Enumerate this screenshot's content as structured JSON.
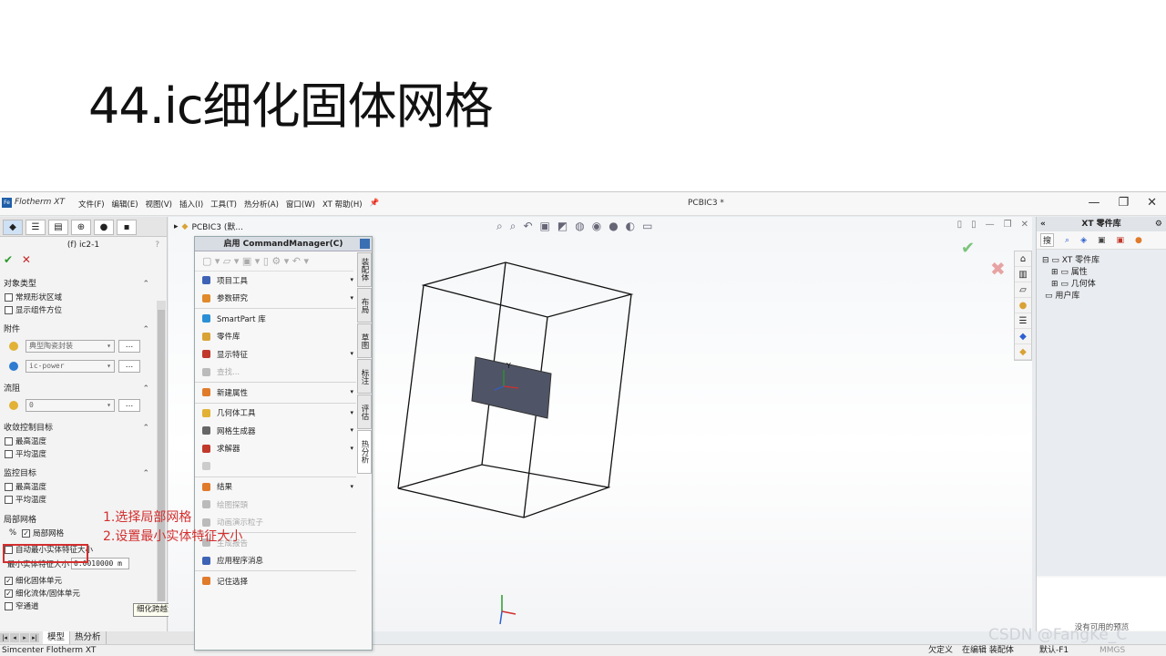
{
  "slide_title": "44.ic细化固体网格",
  "app": {
    "logo": "Fe",
    "name": "Flotherm XT",
    "menu": [
      "文件(F)",
      "编辑(E)",
      "视图(V)",
      "插入(I)",
      "工具(T)",
      "热分析(A)",
      "窗口(W)",
      "XT 帮助(H)"
    ],
    "document_title": "PCBIC3 *",
    "window_controls": [
      "—",
      "❐",
      "✕"
    ]
  },
  "left_panel": {
    "header": "(f) ic2-1",
    "help": "?",
    "ok": "✔",
    "cancel": "✕",
    "sections": {
      "object_type": {
        "title": "对象类型",
        "items": [
          "常规形状区域",
          "显示组件方位"
        ]
      },
      "attachment": {
        "title": "附件",
        "combo1": "典型陶瓷封装",
        "combo2": "ic-power",
        "dots": "..."
      },
      "flow": {
        "title": "流阻",
        "combo": "0",
        "dots": "..."
      },
      "convergence": {
        "title": "收敛控制目标",
        "items": [
          "最高温度",
          "平均温度"
        ]
      },
      "monitor": {
        "title": "监控目标",
        "items": [
          "最高温度",
          "平均温度"
        ]
      },
      "local_mesh": {
        "title": "局部网格",
        "mesh_icon": "%",
        "checkbox_label": "局部网格",
        "auto_label": "自动最小实体特征大小",
        "min_label": "最小实体特征大小",
        "min_value": "0.0010000 m",
        "refine_solid": "细化固体单元",
        "refine_fluid_solid": "细化流体/固体单元",
        "narrow": "窄通道"
      }
    },
    "tooltip": "细化跨越流体/固体交界面的单元",
    "bottom_tabs": [
      "模型",
      "热分析"
    ]
  },
  "annotations": [
    "1.选择局部网格",
    "2.设置最小实体特征大小"
  ],
  "viewport": {
    "tree_root": "PCBIC3 (默...",
    "axis_label": "Y"
  },
  "command_manager": {
    "title": "启用 CommandManager(C)",
    "items": [
      {
        "label": "项目工具",
        "color": "#3e63b5",
        "arrow": true,
        "disabled": false
      },
      {
        "label": "参数研究",
        "color": "#e08a2c",
        "arrow": true,
        "disabled": false
      },
      {
        "sep": true
      },
      {
        "label": "SmartPart 库",
        "color": "#2b8fd6",
        "arrow": false,
        "disabled": false
      },
      {
        "label": "零件库",
        "color": "#d9a235",
        "arrow": false,
        "disabled": false
      },
      {
        "label": "显示特征",
        "color": "#c0392b",
        "arrow": true,
        "disabled": false
      },
      {
        "label": "查找...",
        "color": "#bbbbbb",
        "arrow": false,
        "disabled": true
      },
      {
        "sep": true
      },
      {
        "label": "新建属性",
        "color": "#e07b2c",
        "arrow": true,
        "disabled": false
      },
      {
        "sep": true
      },
      {
        "label": "几何体工具",
        "color": "#e2b236",
        "arrow": true,
        "disabled": false
      },
      {
        "label": "网格生成器",
        "color": "#666666",
        "arrow": true,
        "disabled": false
      },
      {
        "label": "求解器",
        "color": "#c0392b",
        "arrow": true,
        "disabled": false
      },
      {
        "label": "",
        "color": "#cccccc",
        "arrow": false,
        "disabled": true
      },
      {
        "sep": true
      },
      {
        "label": "结果",
        "color": "#e07b2c",
        "arrow": true,
        "disabled": false
      },
      {
        "label": "绘图探頭",
        "color": "#bbbbbb",
        "arrow": false,
        "disabled": true
      },
      {
        "label": "动画演示粒子",
        "color": "#bbbbbb",
        "arrow": false,
        "disabled": true
      },
      {
        "sep": true
      },
      {
        "label": "生成报告",
        "color": "#bbbbbb",
        "arrow": false,
        "disabled": true
      },
      {
        "label": "应用程序消息",
        "color": "#3e63b5",
        "arrow": false,
        "disabled": false
      },
      {
        "sep": true
      },
      {
        "label": "记住选择",
        "color": "#e07b2c",
        "arrow": false,
        "disabled": false
      }
    ],
    "vertical_tabs": [
      "装配体",
      "布局",
      "草图",
      "标注",
      "评估",
      "热分析"
    ]
  },
  "right_panel": {
    "title": "XT 零件库",
    "collapse": "«",
    "search_tab": "搜",
    "tree": [
      "XT 零件库",
      "属性",
      "几何体",
      "用户库"
    ],
    "preview": "没有可用的预览"
  },
  "status_bar": {
    "app": "Simcenter Flotherm XT",
    "s1": "欠定义",
    "s2": "在编辑 装配体",
    "s3": "默认-F1",
    "s4": "MMGS"
  },
  "watermark": "CSDN @FangKe_C",
  "colors": {
    "accent_red": "#d32f2f",
    "panel_bg": "#f3f3f3"
  }
}
